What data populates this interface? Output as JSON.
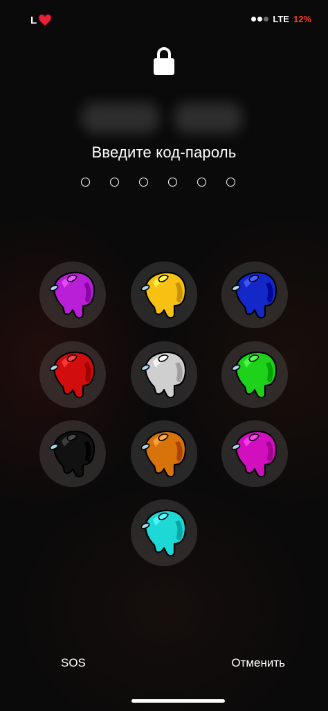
{
  "status_bar": {
    "carrier_label": "L",
    "carrier_heart_icon": "heart-icon",
    "network": "LTE",
    "battery": "12%",
    "battery_color": "#ff3b30"
  },
  "lock": {
    "icon": "lock-icon",
    "prompt": "Введите код-пароль",
    "passcode_length": 6,
    "entered_digits": 0
  },
  "keypad": {
    "keys": [
      {
        "color": "#b91fd6",
        "icon": "crewmate-purple-icon"
      },
      {
        "color": "#f7c114",
        "icon": "crewmate-yellow-icon"
      },
      {
        "color": "#1428c8",
        "icon": "crewmate-blue-icon"
      },
      {
        "color": "#d10d0d",
        "icon": "crewmate-red-icon"
      },
      {
        "color": "#cfcfcf",
        "icon": "crewmate-white-icon"
      },
      {
        "color": "#1ed21b",
        "icon": "crewmate-green-icon"
      },
      {
        "color": "#111111",
        "icon": "crewmate-black-icon"
      },
      {
        "color": "#d8730c",
        "icon": "crewmate-orange-icon"
      },
      {
        "color": "#d10fbe",
        "icon": "crewmate-pink-icon"
      },
      {
        "color": "#1ed8d6",
        "icon": "crewmate-cyan-icon"
      }
    ]
  },
  "bottom": {
    "left_label": "SOS",
    "right_label": "Отменить"
  }
}
